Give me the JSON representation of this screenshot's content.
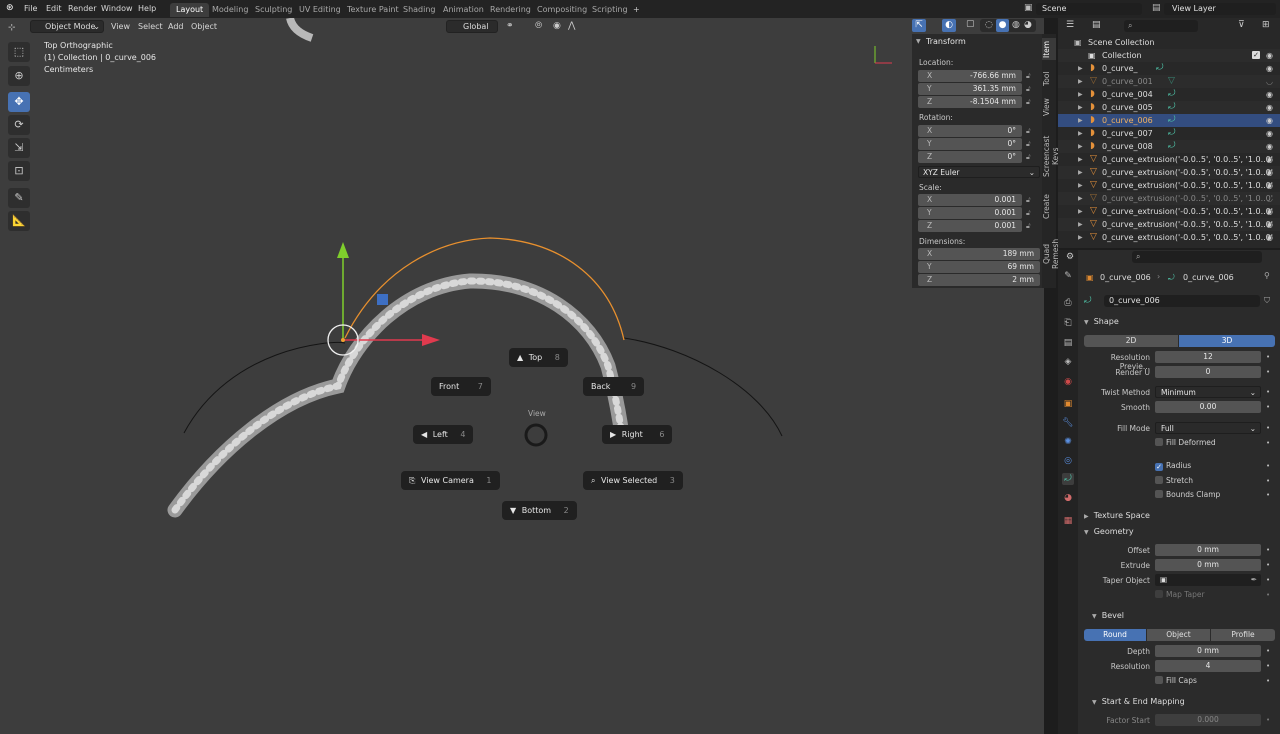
{
  "topbar": {
    "menus": [
      "File",
      "Edit",
      "Render",
      "Window",
      "Help"
    ],
    "workspaces": [
      "Layout",
      "Modeling",
      "Sculpting",
      "UV Editing",
      "Texture Paint",
      "Shading",
      "Animation",
      "Rendering",
      "Compositing",
      "Scripting"
    ],
    "add_tab": "+",
    "scene": "Scene",
    "view_layer": "View Layer"
  },
  "viewport": {
    "mode": "Object Mode",
    "menus": [
      "View",
      "Select",
      "Add",
      "Object"
    ],
    "orientation": "Global",
    "info": {
      "view_name": "Top Orthographic",
      "collection": "(1) Collection | 0_curve_006",
      "units": "Centimeters"
    },
    "pie_menu": {
      "title": "View",
      "items": {
        "top": {
          "label": "Top",
          "key": "8"
        },
        "front": {
          "label": "Front",
          "key": "7"
        },
        "back": {
          "label": "Back",
          "key": "9"
        },
        "left": {
          "label": "Left",
          "key": "4"
        },
        "right": {
          "label": "Right",
          "key": "6"
        },
        "view_camera": {
          "label": "View Camera",
          "key": "1"
        },
        "view_selected": {
          "label": "View Selected",
          "key": "3"
        },
        "bottom": {
          "label": "Bottom",
          "key": "2"
        }
      }
    }
  },
  "npanel": {
    "header": "Transform",
    "location_label": "Location:",
    "location": {
      "x": "-766.66 mm",
      "y": "361.35 mm",
      "z": "-8.1504 mm"
    },
    "rotation_label": "Rotation:",
    "rotation": {
      "x": "0°",
      "y": "0°",
      "z": "0°"
    },
    "rotation_mode": "XYZ Euler",
    "scale_label": "Scale:",
    "scale": {
      "x": "0.001",
      "y": "0.001",
      "z": "0.001"
    },
    "dimensions_label": "Dimensions:",
    "dimensions": {
      "x": "189 mm",
      "y": "69 mm",
      "z": "2 mm"
    },
    "axes": {
      "x": "X",
      "y": "Y",
      "z": "Z"
    },
    "tabs": [
      "Item",
      "Tool",
      "View",
      "Screencast Keys",
      "Create",
      "Quad Remesh"
    ]
  },
  "outliner": {
    "scene_collection": "Scene Collection",
    "collection": "Collection",
    "items": [
      {
        "name": "0_curve_",
        "state": "normal"
      },
      {
        "name": "0_curve_001",
        "state": "dim"
      },
      {
        "name": "0_curve_004",
        "state": "normal"
      },
      {
        "name": "0_curve_005",
        "state": "normal"
      },
      {
        "name": "0_curve_006",
        "state": "selected"
      },
      {
        "name": "0_curve_007",
        "state": "normal"
      },
      {
        "name": "0_curve_008",
        "state": "normal"
      },
      {
        "name": "0_curve_extrusion('-0.0..5', '0.0..5', '1.0..0'",
        "state": "normal"
      },
      {
        "name": "0_curve_extrusion('-0.0..5', '0.0..5', '1.0..0'",
        "state": "normal"
      },
      {
        "name": "0_curve_extrusion('-0.0..5', '0.0..5', '1.0..0'",
        "state": "normal"
      },
      {
        "name": "0_curve_extrusion('-0.0..5', '0.0..5', '1.0..0'",
        "state": "dim"
      },
      {
        "name": "0_curve_extrusion('-0.0..5', '0.0..5', '1.0..0'",
        "state": "normal"
      },
      {
        "name": "0_curve_extrusion('-0.0..5', '0.0..5', '1.0..0'",
        "state": "normal"
      },
      {
        "name": "0_curve_extrusion('-0.0..5', '0.0..5', '1.0..0'",
        "state": "normal"
      }
    ]
  },
  "properties": {
    "object_name": "0_curve_006",
    "data_name": "0_curve_006",
    "datablock": "0_curve_006",
    "shape": {
      "header": "Shape",
      "dim_2d": "2D",
      "dim_3d": "3D",
      "resolution_preview_label": "Resolution Previe...",
      "resolution_preview": "12",
      "render_u_label": "Render U",
      "render_u": "0",
      "twist_method_label": "Twist Method",
      "twist_method": "Minimum",
      "smooth_label": "Smooth",
      "smooth": "0.00",
      "fill_mode_label": "Fill Mode",
      "fill_mode": "Full",
      "fill_deformed": "Fill Deformed",
      "radius": "Radius",
      "stretch": "Stretch",
      "bounds_clamp": "Bounds Clamp"
    },
    "texture_space": "Texture Space",
    "geometry": {
      "header": "Geometry",
      "offset_label": "Offset",
      "offset": "0 mm",
      "extrude_label": "Extrude",
      "extrude": "0 mm",
      "taper_object_label": "Taper Object",
      "map_taper": "Map Taper"
    },
    "bevel": {
      "header": "Bevel",
      "round": "Round",
      "object": "Object",
      "profile": "Profile",
      "depth_label": "Depth",
      "depth": "0 mm",
      "resolution_label": "Resolution",
      "resolution": "4",
      "fill_caps": "Fill Caps"
    },
    "mapping": {
      "header": "Start & End Mapping",
      "factor_start_label": "Factor Start",
      "factor_start": "0.000"
    }
  }
}
